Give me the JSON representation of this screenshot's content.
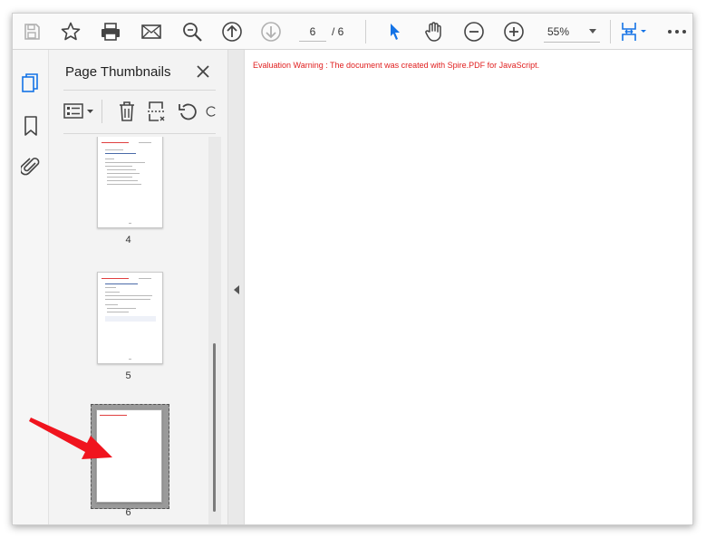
{
  "toolbar": {
    "current_page": "6",
    "page_total": "/ 6",
    "zoom": "55%",
    "icons": [
      "save-icon",
      "star-icon",
      "print-icon",
      "mail-icon",
      "search-icon",
      "previous-page-icon",
      "next-page-icon",
      "select-cursor-icon",
      "hand-icon",
      "zoom-out-icon",
      "zoom-in-icon",
      "page-fit-icon",
      "more-icon"
    ]
  },
  "iconbar": {
    "icons": [
      "page-thumbnails-icon",
      "bookmarks-icon",
      "attachments-icon"
    ]
  },
  "panel": {
    "title": "Page Thumbnails",
    "icons": [
      "thumbnail-options-icon",
      "delete-icon",
      "extract-icon",
      "rotate-icon"
    ],
    "thumbnails": [
      {
        "page": "4"
      },
      {
        "page": "5"
      },
      {
        "page": "6",
        "selected": true
      }
    ]
  },
  "document": {
    "eval_warning": "Evaluation Warning : The document was created with Spire.PDF for JavaScript."
  },
  "colors": {
    "accent": "#1473e6",
    "warning": "#e01e1e",
    "annotation_arrow": "#f0141e"
  }
}
